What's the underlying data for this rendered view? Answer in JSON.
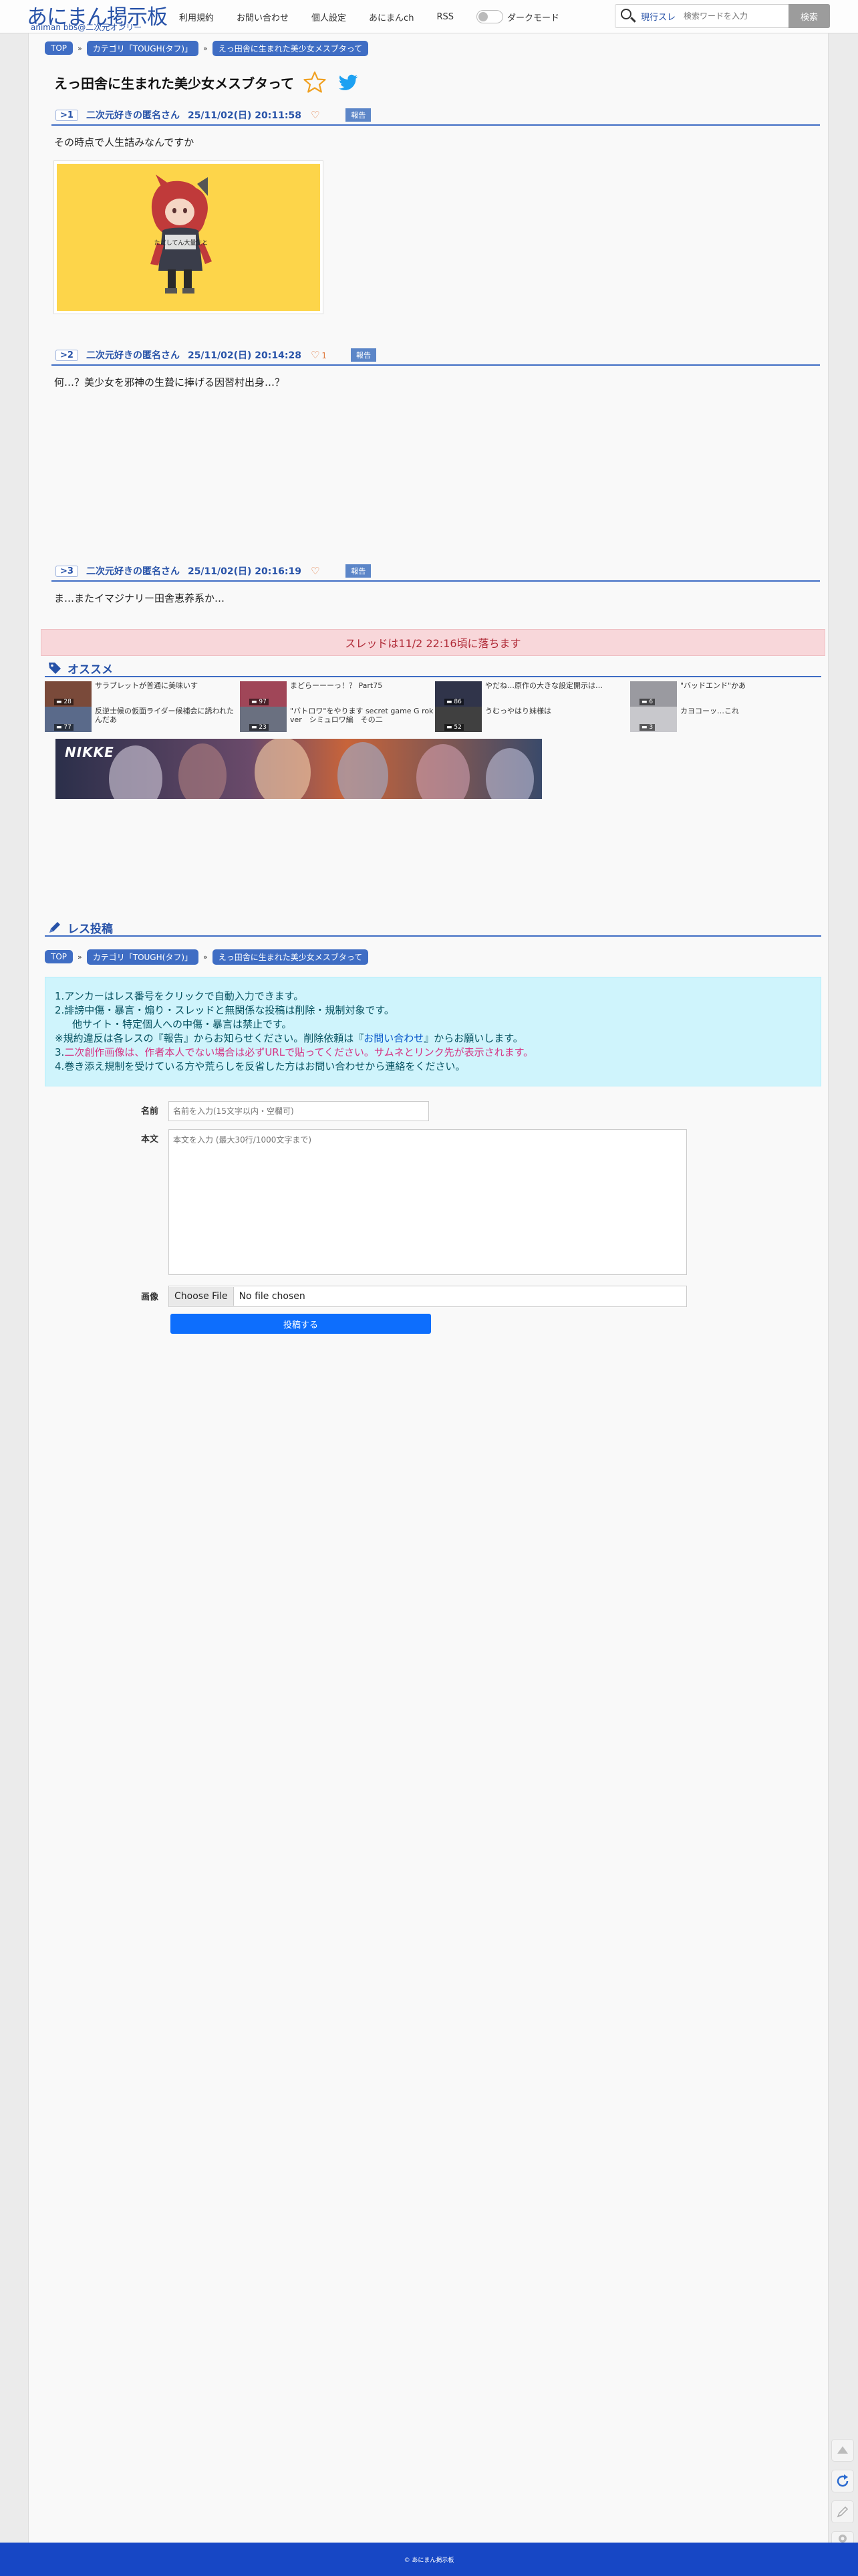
{
  "header": {
    "logo_main": "あにまん掲示板",
    "logo_sub": "animan bbs@二次元オンリー",
    "nav": [
      "利用規約",
      "お問い合わせ",
      "個人設定",
      "あにまんch",
      "RSS"
    ],
    "dark_mode_label": "ダークモード",
    "search": {
      "mode_label": "現行スレ",
      "placeholder": "検索ワードを入力",
      "button_label": "検索"
    }
  },
  "breadcrumb": [
    "TOP",
    "カテゴリ「TOUGH(タフ)」",
    "えっ田舎に生まれた美少女メスブタって"
  ],
  "thread_title": "えっ田舎に生まれた美少女メスブタって",
  "posts": [
    {
      "num": "1",
      "name": "二次元好きの匿名さん",
      "date": "25/11/02(日) 20:11:58",
      "likes": "",
      "report": "報告",
      "body": "その時点で人生詰みなんですか",
      "image_caption": "ただしてん大量生と"
    },
    {
      "num": "2",
      "name": "二次元好きの匿名さん",
      "date": "25/11/02(日) 20:14:28",
      "likes": "1",
      "report": "報告",
      "body": "何…？美少女を邪神の生贄に捧げる因習村出身…？"
    },
    {
      "num": "3",
      "name": "二次元好きの匿名さん",
      "date": "25/11/02(日) 20:16:19",
      "likes": "",
      "report": "報告",
      "body": "ま…またイマジナリー田舎恵养系か…"
    }
  ],
  "thread_end_notice": "スレッドは11/2 22:16頃に落ちます",
  "recommend": {
    "title": "オススメ",
    "items": [
      {
        "title": "サラブレットが普通に美味いす",
        "count": "28",
        "color": "#7a4a3a"
      },
      {
        "title": "まどらーーーっ！？ Part75",
        "count": "97",
        "color": "#a04658"
      },
      {
        "title": "やだね…原作の大きな設定開示は…",
        "count": "86",
        "color": "#30344a"
      },
      {
        "title": "\"バッドエンド\"かあ",
        "count": "6",
        "color": "#9a9aa0"
      },
      {
        "title": "反逆士候の仮面ライダー候補会に誘われたんだあ",
        "count": "77",
        "color": "#5a6a8a"
      },
      {
        "title": "\"バトロワ\"をやります secret game G rok ver　シミュロワ編　その二",
        "count": "23",
        "color": "#6a7080"
      },
      {
        "title": "うむっやはり妹様は",
        "count": "52",
        "color": "#404040"
      },
      {
        "title": "カヨコーッ…これ",
        "count": "3",
        "color": "#c8c8cc"
      }
    ],
    "banner_label": "NIKKE"
  },
  "res_form": {
    "title": "レス投稿",
    "breadcrumb": [
      "TOP",
      "カテゴリ「TOUGH(タフ)」",
      "えっ田舎に生まれた美少女メスブタって"
    ],
    "notice": {
      "l1": "1.アンカーはレス番号をクリックで自動入力できます。",
      "l2": "2.誹謗中傷・暴言・煽り・スレッドと無関係な投稿は削除・規制対象です。",
      "l3": "他サイト・特定個人への中傷・暴言は禁止です。",
      "l4a": "※規約違反は各レスの『報告』からお知らせください。削除依頼は『",
      "l4b": "お問い合わせ",
      "l4c": "』からお願いします。",
      "l5a": "3.",
      "l5b": "二次創作画像は、作者本人でない場合は必ずURLで貼ってください。サムネとリンク先が表示されます。",
      "l6": "4.巻き添え規制を受けている方や荒らしを反省した方はお問い合わせから連絡をください。"
    },
    "name_label": "名前",
    "name_placeholder": "名前を入力(15文字以内・空欄可)",
    "body_label": "本文",
    "body_placeholder": "本文を入力 (最大30行/1000文字まで)",
    "image_label": "画像",
    "file_button": "Choose File",
    "file_text": "No file chosen",
    "submit_label": "投稿する"
  },
  "footer": "© あにまん掲示板",
  "colors": {
    "accent": "#3f6dc4",
    "brand": "#2752a8",
    "footer": "#1747c5",
    "thread_end_bg": "#f8d7da",
    "notice_bg": "#cff4fc",
    "submit": "#0d6efd"
  }
}
